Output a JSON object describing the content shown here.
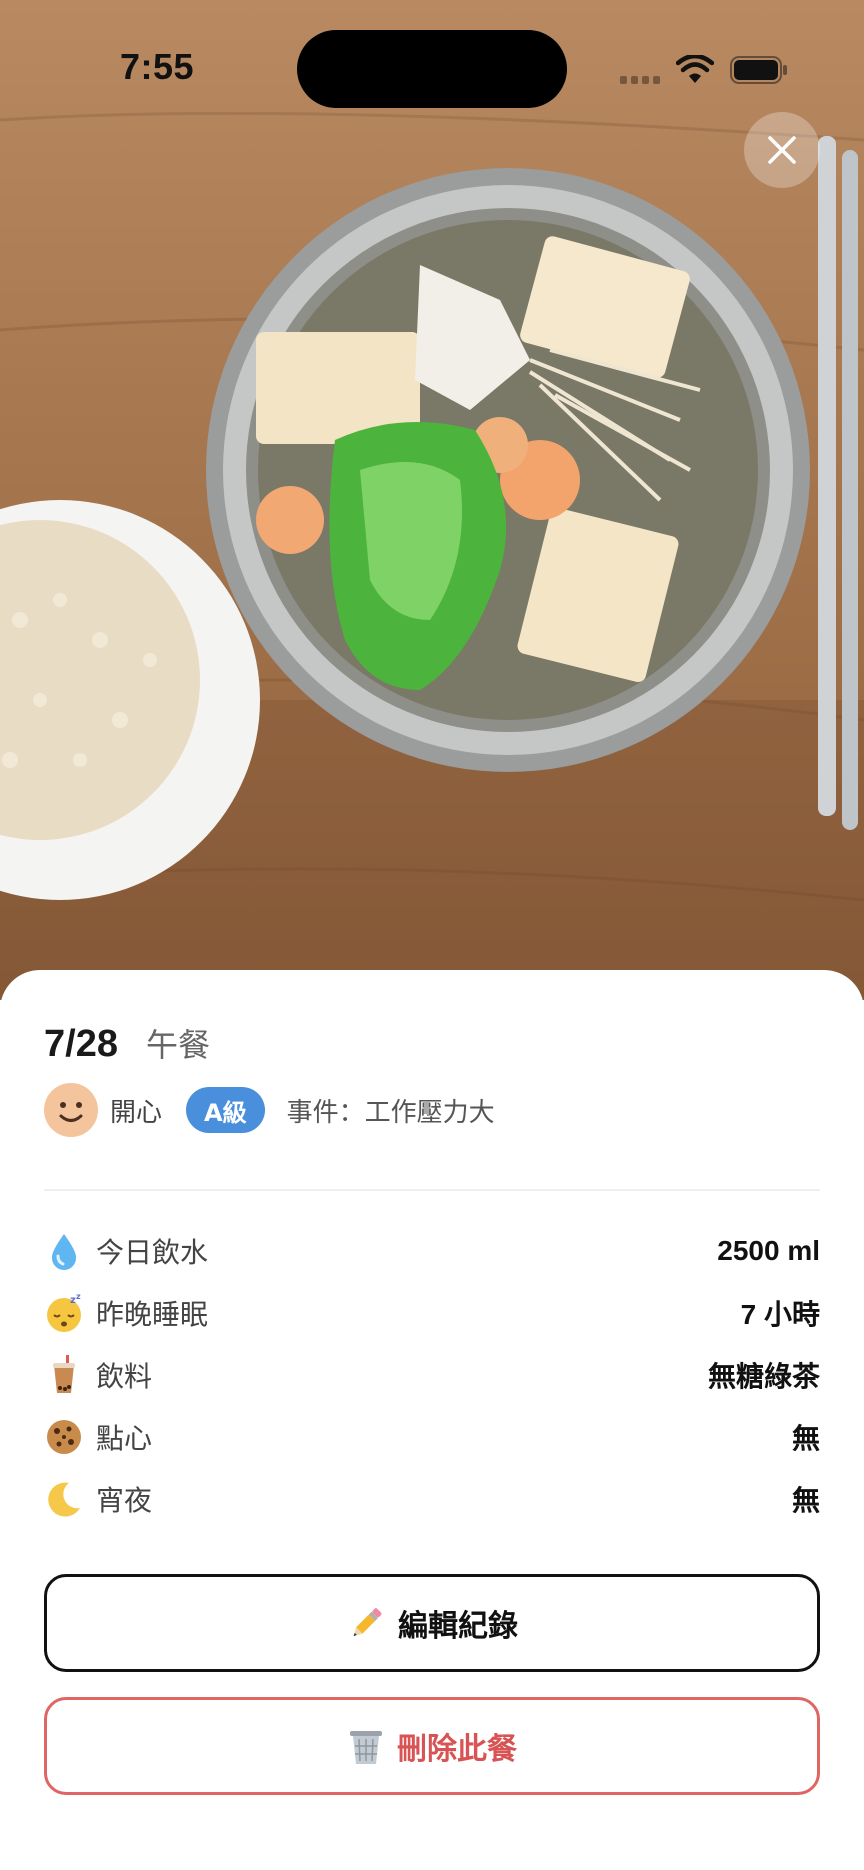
{
  "status_bar": {
    "time": "7:55"
  },
  "record": {
    "date": "7/28",
    "meal": "午餐",
    "mood": "開心",
    "grade": "A級",
    "event": "事件：工作壓力大"
  },
  "stats": [
    {
      "icon": "water-drop-icon",
      "label": "今日飲水",
      "value": "2500 ml"
    },
    {
      "icon": "sleeping-face-icon",
      "label": "昨晚睡眠",
      "value": "7 小時"
    },
    {
      "icon": "bubble-tea-icon",
      "label": "飲料",
      "value": "無糖綠茶"
    },
    {
      "icon": "cookie-icon",
      "label": "點心",
      "value": "無"
    },
    {
      "icon": "crescent-moon-icon",
      "label": "宵夜",
      "value": "無"
    }
  ],
  "actions": {
    "edit_label": "編輯紀錄",
    "edit_icon": "pencil-icon",
    "delete_label": "刪除此餐",
    "delete_icon": "trash-can-icon"
  },
  "colors": {
    "grade_badge": "#4a8fdc",
    "delete": "#d85454",
    "mood_face": "#f4c49c"
  }
}
